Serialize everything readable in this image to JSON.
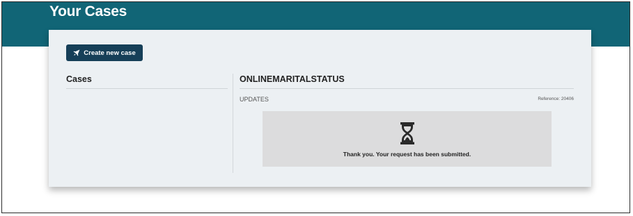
{
  "header": {
    "title": "Your Cases"
  },
  "toolbar": {
    "create_label": "Create new case"
  },
  "left_panel": {
    "title": "Cases"
  },
  "case": {
    "title": "ONLINEMARITALSTATUS",
    "updates_label": "UPDATES",
    "reference": "Reference: 20406",
    "status_message": "Thank you. Your request has been submitted."
  },
  "icons": {
    "create": "rocket-icon",
    "status": "hourglass-icon"
  },
  "colors": {
    "header": "#116576",
    "button": "#163f58",
    "card": "#ecf0f3",
    "panel": "#dcdcdd"
  }
}
